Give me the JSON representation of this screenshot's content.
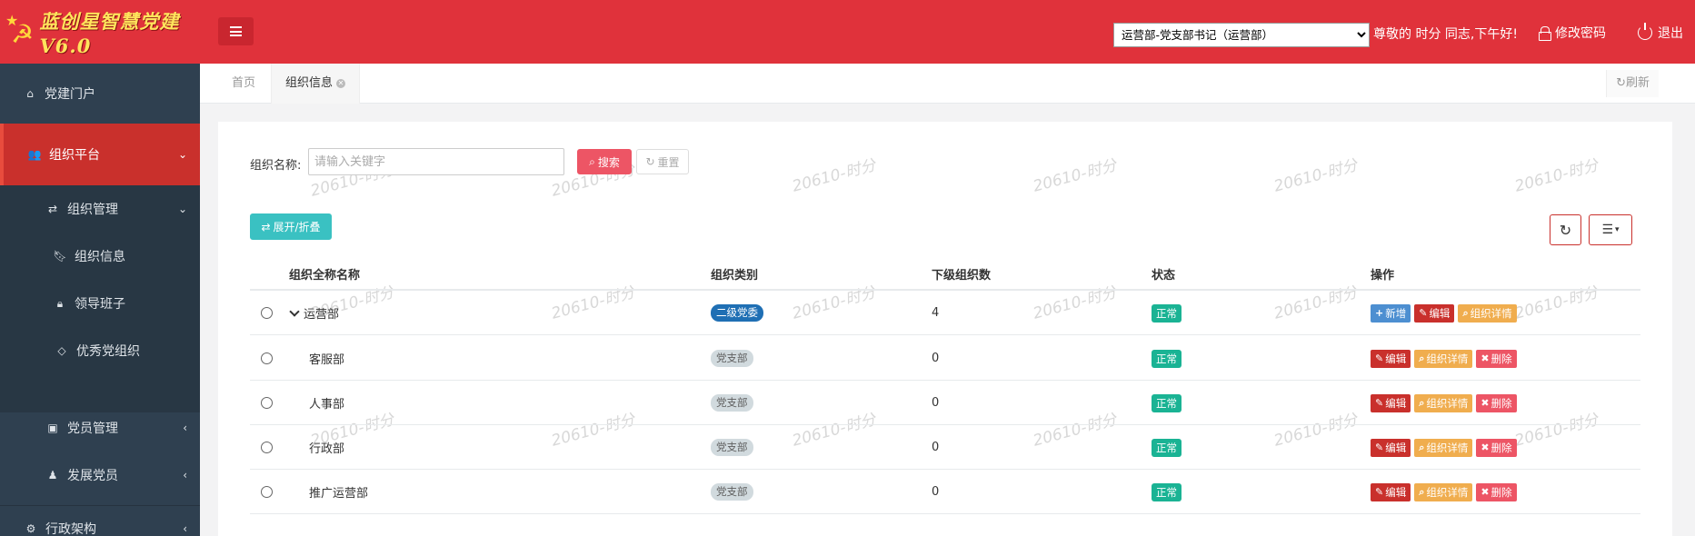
{
  "header": {
    "brand": "蓝创星智慧党建V6.0",
    "role_options": [
      "运营部-党支部书记（运营部）"
    ],
    "role_selected": "运营部-党支部书记（运营部）",
    "greeting": "尊敬的 时分 同志,下午好!",
    "change_password": "修改密码",
    "logout": "退出"
  },
  "sidebar": {
    "items": [
      {
        "label": "党建门户",
        "icon": "home-icon"
      },
      {
        "label": "组织平台",
        "icon": "users-icon"
      },
      {
        "label": "组织管理",
        "icon": "exchange-icon"
      },
      {
        "label": "组织信息",
        "icon": "bookmark-icon"
      },
      {
        "label": "领导班子",
        "icon": "lock-person-icon"
      },
      {
        "label": "优秀党组织",
        "icon": "diamond-icon"
      },
      {
        "label": "党员管理",
        "icon": "id-card-icon"
      },
      {
        "label": "发展党员",
        "icon": "person-icon"
      },
      {
        "label": "行政架构",
        "icon": "cogs-icon"
      }
    ]
  },
  "tabs": {
    "home": "首页",
    "current": "组织信息",
    "refresh": "刷新"
  },
  "search": {
    "label": "组织名称:",
    "placeholder": "请输入关键字",
    "search_btn": "搜索",
    "reset_btn": "重置"
  },
  "toolbar": {
    "expand_btn": "展开/折叠"
  },
  "watermark": "20610-时分",
  "table": {
    "columns": [
      "组织全称名称",
      "组织类别",
      "下级组织数",
      "状态",
      "操作"
    ],
    "rows": [
      {
        "name": "运营部",
        "category": "二级党委",
        "count": "4",
        "status": "正常",
        "actions": [
          "新增",
          "编辑",
          "组织详情"
        ]
      },
      {
        "name": "客服部",
        "category": "党支部",
        "count": "0",
        "status": "正常",
        "actions": [
          "编辑",
          "组织详情",
          "删除"
        ]
      },
      {
        "name": "人事部",
        "category": "党支部",
        "count": "0",
        "status": "正常",
        "actions": [
          "编辑",
          "组织详情",
          "删除"
        ]
      },
      {
        "name": "行政部",
        "category": "党支部",
        "count": "0",
        "status": "正常",
        "actions": [
          "编辑",
          "组织详情",
          "删除"
        ]
      },
      {
        "name": "推广运营部",
        "category": "党支部",
        "count": "0",
        "status": "正常",
        "actions": [
          "编辑",
          "组织详情",
          "删除"
        ]
      }
    ]
  },
  "colors": {
    "header_red": "#e0323b",
    "sidebar_dark": "#2f4050",
    "active_red": "#c9302c",
    "status_green": "#1ab394",
    "badge_blue": "#1f6fb4"
  }
}
